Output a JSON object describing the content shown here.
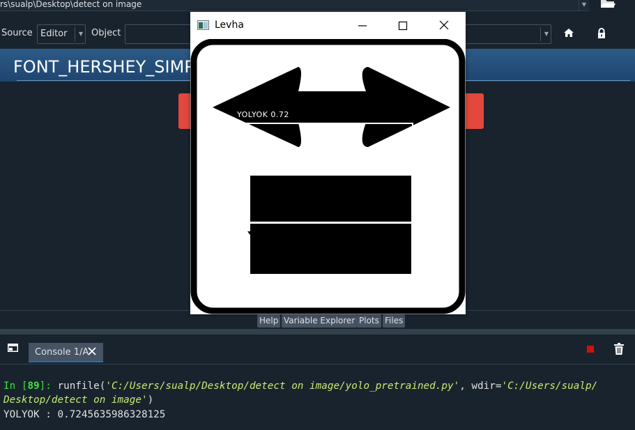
{
  "path_bar": {
    "path": "rs\\sualp\\Desktop\\detect on image"
  },
  "toolbar": {
    "source_label": "Source",
    "source_value": "Editor",
    "object_label": "Object"
  },
  "help_pane": {
    "title": "FONT_HERSHEY_SIMP"
  },
  "pane_tabs": [
    "Help",
    "Variable Explorer",
    "Plots",
    "Files"
  ],
  "console": {
    "tab_label": "Console 1/A",
    "prompt_in": "In [",
    "prompt_num": "89",
    "prompt_end": "]: ",
    "cmd_func": "runfile(",
    "cmd_arg1": "'C:/Users/sualp/Desktop/detect on image/yolo_pretrained.py'",
    "cmd_sep": ", wdir=",
    "cmd_arg2a": "'C:/Users/sualp/",
    "cmd_arg2b": "Desktop/detect on image'",
    "cmd_close": ")",
    "output": "YOLYOK : 0.7245635986328125"
  },
  "cv_window": {
    "title": "Levha",
    "detection_label": "YOLYOK 0.72"
  },
  "colors": {
    "background": "#19232d",
    "help_header": "#2c5a86",
    "red_banner": "#e2483d",
    "prompt_green": "#3ce33c",
    "string_yellowgreen": "#c8eb74",
    "stop_red": "#c8150e"
  },
  "icons": [
    "folder-open-icon",
    "home-icon",
    "lock-icon",
    "console-window-icon",
    "close-icon",
    "stop-icon",
    "trash-icon",
    "app-icon",
    "minimize-icon",
    "maximize-icon"
  ]
}
